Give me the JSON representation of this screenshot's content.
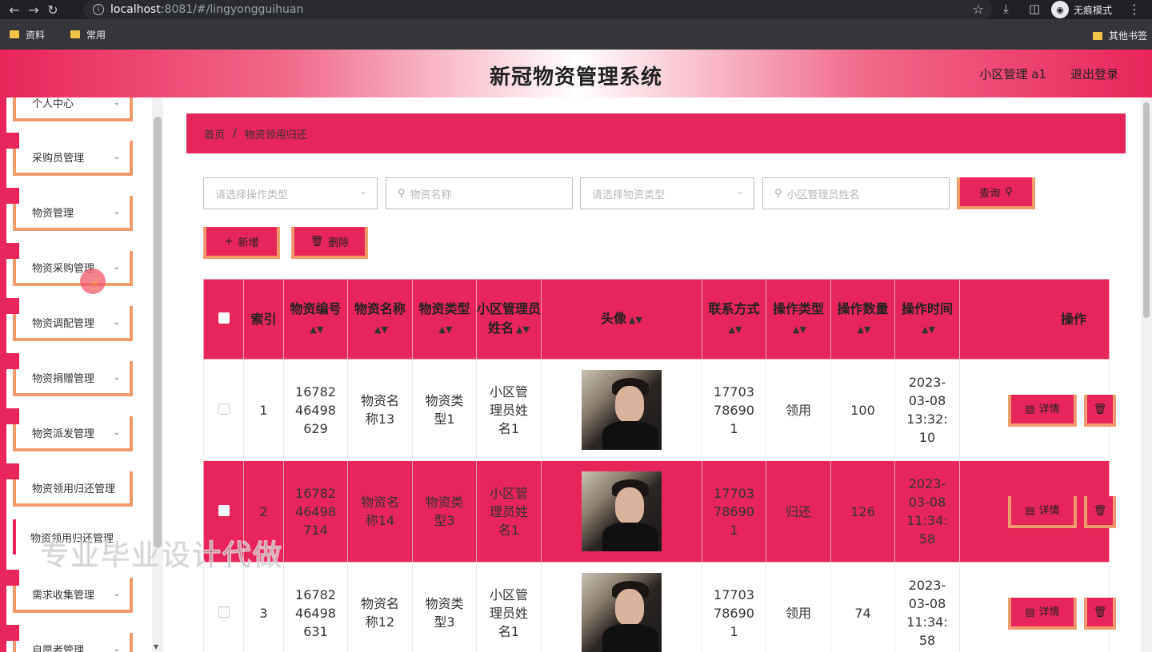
{
  "browser": {
    "url_host": "localhost",
    "url_path": ":8081/#/lingyongguihuan",
    "incognito_label": "无痕模式"
  },
  "bookmarks": {
    "items": [
      "资料",
      "常用"
    ],
    "other": "其他书签"
  },
  "header": {
    "title": "新冠物资管理系统",
    "user": "小区管理 a1",
    "logout": "退出登录"
  },
  "sidebar": {
    "items": [
      "个人中心",
      "采购员管理",
      "物资管理",
      "物资采购管理",
      "物资调配管理",
      "物资捐赠管理",
      "物资派发管理",
      "物资领用归还管理",
      "需求收集管理",
      "自愿者管理"
    ],
    "sub_item": "物资领用归还管理"
  },
  "breadcrumb": {
    "home": "首页",
    "sep": "/",
    "current": "物资领用归还"
  },
  "search": {
    "op_type_placeholder": "请选择操作类型",
    "name_placeholder": "物资名称",
    "type_placeholder": "请选择物资类型",
    "manager_placeholder": "小区管理员姓名",
    "query_label": "查询"
  },
  "actions": {
    "add_label": "新增",
    "delete_label": "删除"
  },
  "table": {
    "headers": {
      "index": "索引",
      "code": "物资编号",
      "name": "物资名称",
      "type": "物资类型",
      "manager": "小区管理员姓名",
      "avatar": "头像",
      "phone": "联系方式",
      "op_type": "操作类型",
      "quantity": "操作数量",
      "time": "操作时间",
      "ops": "操作"
    },
    "rows": [
      {
        "index": "1",
        "code": "1678246498629",
        "name": "物资名称13",
        "type": "物资类型1",
        "manager": "小区管理员姓名1",
        "phone": "17703786901",
        "op_type": "领用",
        "quantity": "100",
        "time": "2023-03-08 13:32:10",
        "detail": "详情"
      },
      {
        "index": "2",
        "code": "1678246498714",
        "name": "物资名称14",
        "type": "物资类型3",
        "manager": "小区管理员姓名1",
        "phone": "17703786901",
        "op_type": "归还",
        "quantity": "126",
        "time": "2023-03-08 11:34:58",
        "detail": "详情"
      },
      {
        "index": "3",
        "code": "1678246498631",
        "name": "物资名称12",
        "type": "物资类型3",
        "manager": "小区管理员姓名1",
        "phone": "17703786901",
        "op_type": "领用",
        "quantity": "74",
        "time": "2023-03-08 11:34:58",
        "detail": "详情"
      }
    ]
  },
  "watermark": "专业毕业设计代做"
}
